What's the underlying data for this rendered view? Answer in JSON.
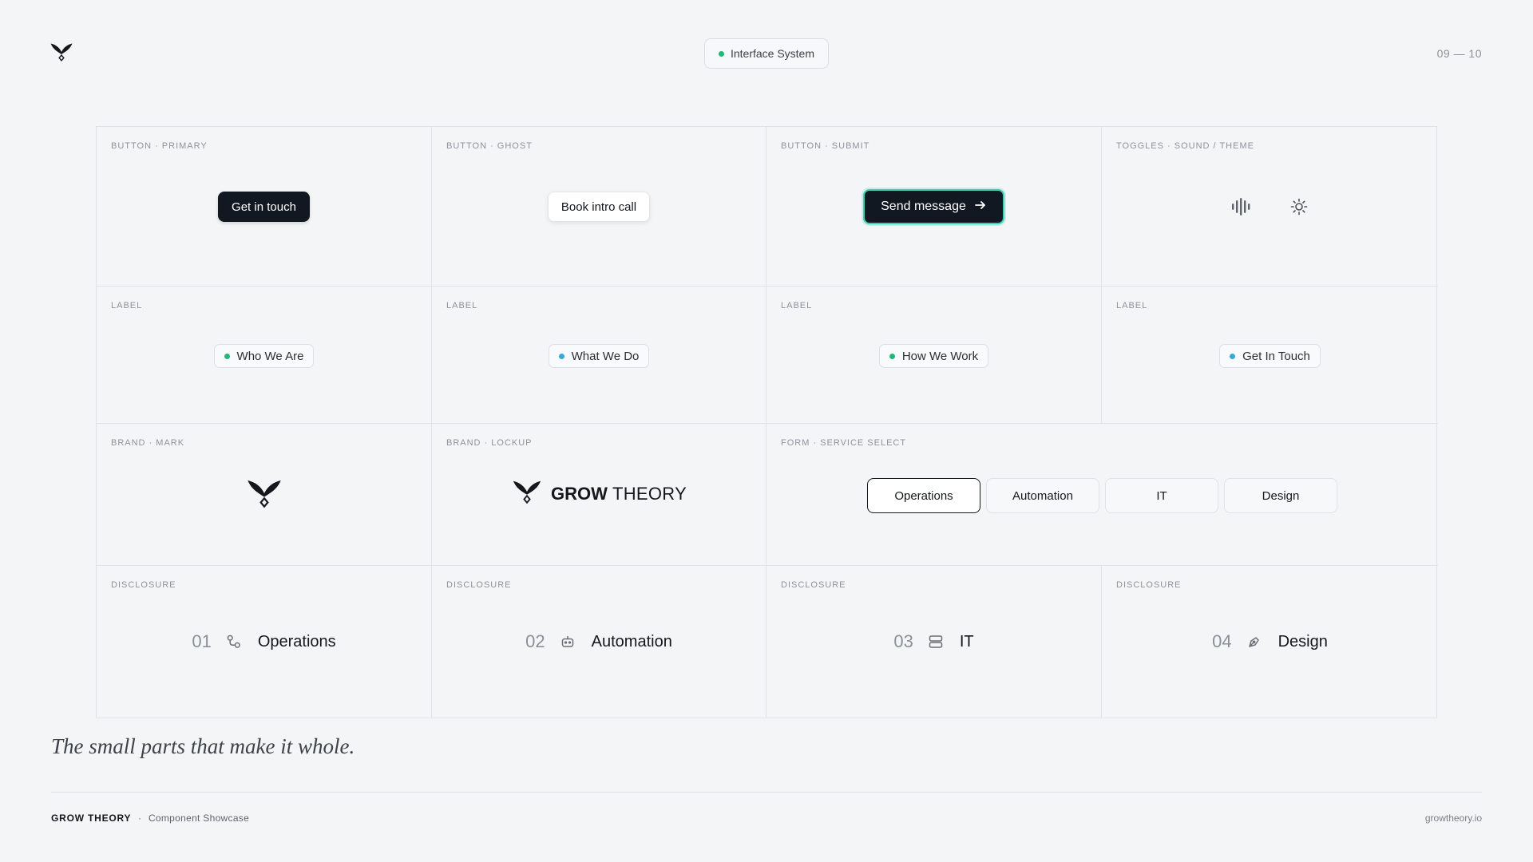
{
  "header": {
    "pill_label": "Interface System",
    "page_number": "09 — 10"
  },
  "cells": {
    "button_primary": {
      "caption": "BUTTON · PRIMARY",
      "label": "Get in touch"
    },
    "button_ghost": {
      "caption": "BUTTON · GHOST",
      "label": "Book intro call"
    },
    "button_submit": {
      "caption": "BUTTON · SUBMIT",
      "label": "Send message"
    },
    "toggles": {
      "caption": "TOGGLES · SOUND / THEME",
      "icons": [
        "sound-wave-icon",
        "sun-icon"
      ]
    },
    "labels": [
      {
        "caption": "LABEL",
        "text": "Who We Are",
        "dot_color": "#22b77a"
      },
      {
        "caption": "LABEL",
        "text": "What We Do",
        "dot_color": "#3aa7d6"
      },
      {
        "caption": "LABEL",
        "text": "How We Work",
        "dot_color": "#22b77a"
      },
      {
        "caption": "LABEL",
        "text": "Get In Touch",
        "dot_color": "#3aa7d6"
      }
    ],
    "brand_mark": {
      "caption": "BRAND · MARK"
    },
    "brand_lockup": {
      "caption": "BRAND · LOCKUP",
      "word_bold": "GROW",
      "word_light": "THEORY"
    },
    "service_select": {
      "caption": "FORM · SERVICE SELECT",
      "options": [
        "Operations",
        "Automation",
        "IT",
        "Design"
      ],
      "selected": "Operations"
    },
    "disclosures": [
      {
        "caption": "DISCLOSURE",
        "num": "01",
        "icon": "workflow-icon",
        "name": "Operations"
      },
      {
        "caption": "DISCLOSURE",
        "num": "02",
        "icon": "robot-icon",
        "name": "Automation"
      },
      {
        "caption": "DISCLOSURE",
        "num": "03",
        "icon": "server-icon",
        "name": "IT"
      },
      {
        "caption": "DISCLOSURE",
        "num": "04",
        "icon": "pen-nib-icon",
        "name": "Design"
      }
    ]
  },
  "tagline": "The small parts that make it whole.",
  "footer": {
    "brand": "GROW THEORY",
    "separator": "·",
    "subtitle": "Component Showcase",
    "url": "growtheory.io"
  },
  "colors": {
    "accent_green": "#22b77a",
    "accent_blue": "#3aa7d6",
    "submit_ring": "#3ecfb0",
    "ink": "#121821"
  }
}
